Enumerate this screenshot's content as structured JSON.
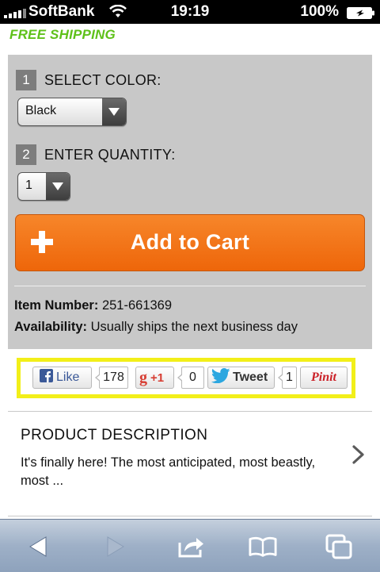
{
  "status_bar": {
    "carrier": "SoftBank",
    "time": "19:19",
    "battery_pct": "100%"
  },
  "promo": {
    "free_shipping": "FREE SHIPPING"
  },
  "options": {
    "step1_number": "1",
    "step1_label": "SELECT COLOR:",
    "color_value": "Black",
    "step2_number": "2",
    "step2_label": "ENTER QUANTITY:",
    "quantity_value": "1"
  },
  "cart": {
    "button_label": "Add to Cart",
    "accent_color": "#f07012"
  },
  "item": {
    "number_label": "Item Number:",
    "number_value": "251-661369",
    "availability_label": "Availability:",
    "availability_value": "Usually ships the next business day"
  },
  "social": {
    "like_label": "Like",
    "like_count": "178",
    "plusone_label": "+1",
    "plusone_count": "0",
    "tweet_label": "Tweet",
    "tweet_count": "1",
    "pinit_label": "Pinit",
    "highlight_color": "#f2ef19"
  },
  "description": {
    "title": "PRODUCT DESCRIPTION",
    "text": "It's finally here! The most anticipated, most beastly, most ..."
  },
  "toolbar": {
    "icons": [
      "back-icon",
      "forward-icon",
      "share-icon",
      "bookmarks-icon",
      "tabs-icon"
    ]
  }
}
